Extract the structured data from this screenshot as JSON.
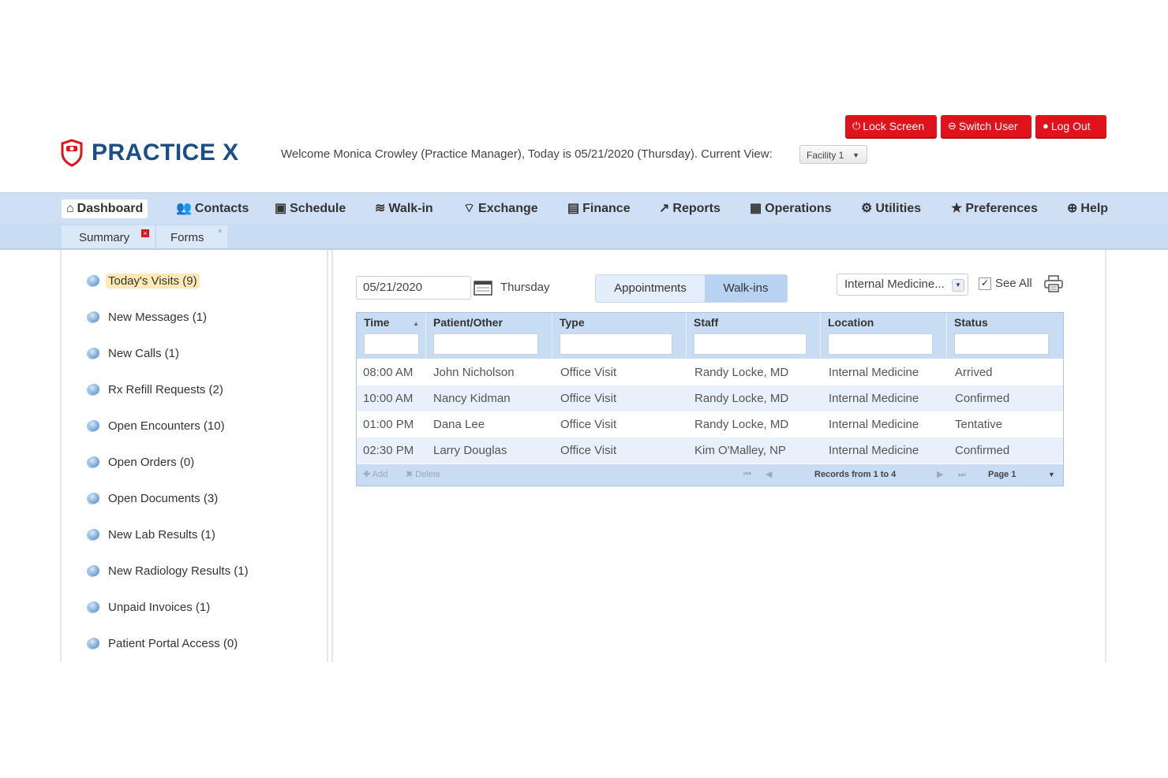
{
  "header": {
    "brand": "PRACTICE X",
    "welcome": "Welcome Monica Crowley (Practice Manager), Today is 05/21/2020 (Thursday).  Current View:",
    "current_view": "Facility 1",
    "buttons": {
      "lock": "Lock Screen",
      "switch": "Switch User",
      "logout": "Log Out"
    }
  },
  "nav": [
    {
      "label": "Dashboard"
    },
    {
      "label": "Contacts"
    },
    {
      "label": "Schedule"
    },
    {
      "label": "Walk-in"
    },
    {
      "label": "Exchange"
    },
    {
      "label": "Finance"
    },
    {
      "label": "Reports"
    },
    {
      "label": "Operations"
    },
    {
      "label": "Utilities"
    },
    {
      "label": "Preferences"
    },
    {
      "label": "Help"
    }
  ],
  "subtabs": [
    {
      "label": "Summary"
    },
    {
      "label": "Forms"
    }
  ],
  "sidebar": {
    "items": [
      {
        "label": "Today's Visits (9)"
      },
      {
        "label": "New Messages (1)"
      },
      {
        "label": "New Calls (1)"
      },
      {
        "label": "Rx Refill Requests (2)"
      },
      {
        "label": "Open Encounters (10)"
      },
      {
        "label": "Open Orders (0)"
      },
      {
        "label": "Open Documents (3)"
      },
      {
        "label": "New Lab Results (1)"
      },
      {
        "label": "New Radiology Results (1)"
      },
      {
        "label": "Unpaid Invoices (1)"
      },
      {
        "label": "Patient Portal Access (0)"
      }
    ]
  },
  "toolbar": {
    "date": "05/21/2020",
    "day": "Thursday",
    "seg_appointments": "Appointments",
    "seg_walkins": "Walk-ins",
    "department": "Internal Medicine...",
    "see_all": "See All"
  },
  "grid": {
    "columns": [
      "Time",
      "Patient/Other",
      "Type",
      "Staff",
      "Location",
      "Status"
    ],
    "rows": [
      {
        "time": "08:00 AM",
        "patient": "John Nicholson",
        "type": "Office Visit",
        "staff": "Randy Locke, MD",
        "location": "Internal Medicine",
        "status": "Arrived"
      },
      {
        "time": "10:00 AM",
        "patient": "Nancy Kidman",
        "type": "Office Visit",
        "staff": "Randy Locke, MD",
        "location": "Internal Medicine",
        "status": "Confirmed"
      },
      {
        "time": "01:00 PM",
        "patient": "Dana Lee",
        "type": "Office Visit",
        "staff": "Randy Locke, MD",
        "location": "Internal Medicine",
        "status": "Tentative"
      },
      {
        "time": "02:30 PM",
        "patient": "Larry Douglas",
        "type": "Office Visit",
        "staff": "Kim O'Malley, NP",
        "location": "Internal Medicine",
        "status": "Confirmed"
      }
    ],
    "pager": {
      "add": "Add",
      "delete": "Delete",
      "records": "Records from 1 to 4",
      "page": "Page 1"
    }
  }
}
